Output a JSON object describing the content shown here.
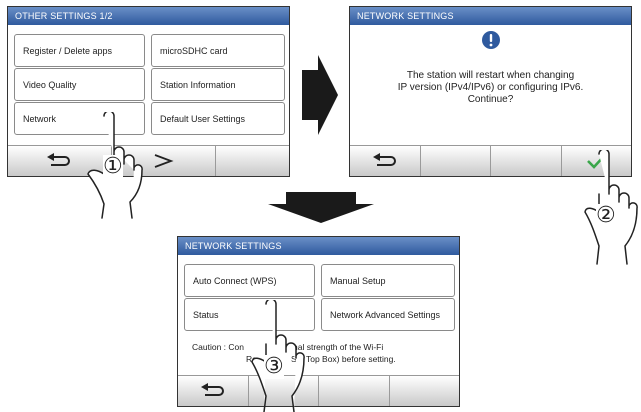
{
  "screen1": {
    "title": "OTHER SETTINGS 1/2",
    "buttons": [
      "Register / Delete apps",
      "microSDHC card",
      "Video Quality",
      "Station Information",
      "Network",
      "Default User Settings"
    ],
    "icons": [
      "back-arrow-icon",
      "next-chevron-icon"
    ]
  },
  "screen2": {
    "title": "NETWORK SETTINGS",
    "message_lines": [
      "The station will restart when changing",
      "IP version (IPv4/IPv6) or configuring IPv6.",
      "Continue?"
    ],
    "alert_icon": "exclamation-icon",
    "confirm_icon": "checkmark-icon",
    "accent": "#3aa64a"
  },
  "screen3": {
    "title": "NETWORK SETTINGS",
    "buttons": [
      "Auto Connect (WPS)",
      "Manual Setup",
      "Status",
      "Network Advanced Settings"
    ],
    "caution_line1_a": "Caution : Con",
    "caution_line1_b": "nal strength of the Wi-Fi",
    "caution_line2_a": "Ro",
    "caution_line2_b": "Set Top Box) before setting."
  },
  "steps": [
    "①",
    "②",
    "③"
  ],
  "colors": {
    "titlebar": "#3b64a8",
    "arrow": "#1a1a1a"
  }
}
